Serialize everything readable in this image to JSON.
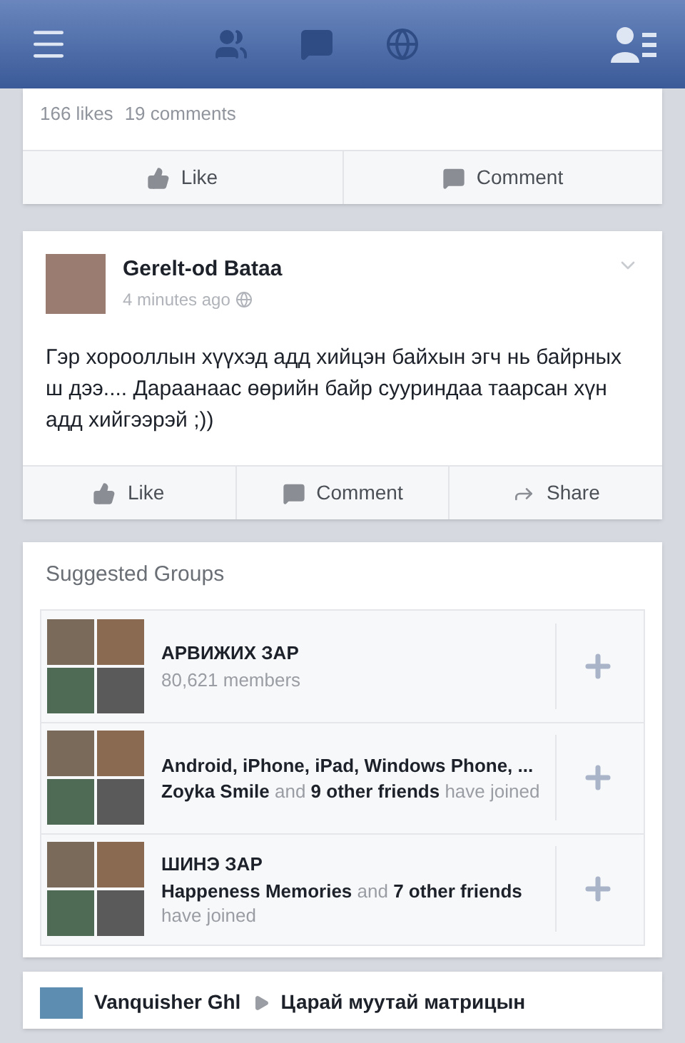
{
  "top_post": {
    "likes": "166 likes",
    "comments": "19 comments",
    "actions": [
      {
        "kind": "like",
        "label": "Like"
      },
      {
        "kind": "comment",
        "label": "Comment"
      }
    ]
  },
  "post": {
    "author": "Gerelt-od Bataa",
    "time": "4 minutes ago",
    "text": "Гэр хорооллын хүүхэд адд хийцэн байхын эгч нь байрных ш дээ.... Дараанаас өөрийн байр сууриндаа таарсан хүн адд хийгээрэй ;))",
    "actions": [
      {
        "kind": "like",
        "label": "Like"
      },
      {
        "kind": "comment",
        "label": "Comment"
      },
      {
        "kind": "share",
        "label": "Share"
      }
    ]
  },
  "suggested_groups": {
    "title": "Suggested Groups",
    "groups": [
      {
        "name": "АРВИЖИХ ЗАР",
        "description": "80,621 members"
      },
      {
        "name": "Android, iPhone, iPad, Windows Phone, ...",
        "description": "**Zoyka Smile** and **9 other friends** have joined"
      },
      {
        "name": "ШИНЭ ЗАР",
        "description": "**Happeness Memories** and **7 other friends** have joined"
      }
    ]
  },
  "next_post": {
    "author": "Vanquisher Ghl",
    "target": "Царай муутай матрицын"
  }
}
